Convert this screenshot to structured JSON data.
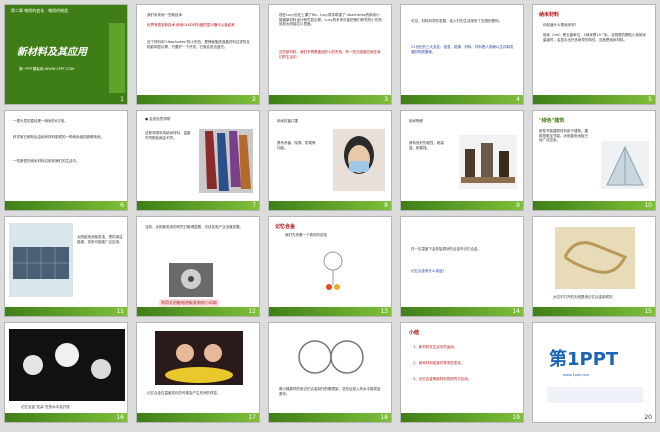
{
  "slides": [
    {
      "num": "1",
      "header": "第二章 物质的变化 · 物质的制造",
      "title": "新材料及其应用",
      "footer": "第一PPT模板网-WWW.1PPT.COM"
    },
    {
      "num": "2",
      "heading": "我们未来用一些新技术",
      "body_red": "世界有很多新技术 使用OLED材料做的显示器可以卷起来",
      "body": "这个材料叫\"Ubachsites\"的小东西，是神秘瓶底液晶材料过滤的互相影响显示屏，只要拧一下开关，它就会发出蓝光。"
    },
    {
      "num": "3",
      "body": "现在Lucy也在上课了Ten. Lucy同学希望了 Ubachsites的纳米小碳管新材料设计研究显示屏。Lucy的未来可能把他们研究的小东西放到太阳能芯片里面。",
      "body_red": "这些新材料、我们不再是遥远的人的东西，有一些已经被应用在我们的生活中。"
    },
    {
      "num": "4",
      "body": "可见，材料科学的发展，给人们的生活带来了无限的便利。",
      "body_blue": "21世纪的三大支柱：信息、能源、材料。材料是人类赖以生存和发展的物质基础。"
    },
    {
      "num": "5",
      "heading": "纳米材料",
      "q": "你知道什么是纳米吗？",
      "body": "纳米（nm）是长度单位，1纳米是10⁻⁹米。当物质的颗粒小到纳米量级时，会显示出许多奇异的特性，这就是纳米材料。"
    },
    {
      "num": "6",
      "body": "一根头发的直径是一纳米的6万倍。",
      "body2": "科学家已研制出由纳米材料制成的一种纳米级的超微电池。",
      "body3": "一些新型的纳米材料应用到我们的生活中。"
    },
    {
      "num": "7",
      "heading": "● 会变色的领带",
      "body": "这种领带采用纳米材料，温度不同颜色就会不同。"
    },
    {
      "num": "8",
      "heading": "纳米抗菌口罩",
      "body": "具有杀菌、除臭、防霉等功能。"
    },
    {
      "num": "9",
      "heading": "纳米陶瓷",
      "body": "具有良好的韧性，耐高温、耐腐蚀。"
    },
    {
      "num": "10",
      "heading": "\"绿色\"建筑",
      "body": "新型节能建筑材料用于建筑，建筑物更加节能。太阳能电池板已经广泛应用。"
    },
    {
      "num": "11",
      "body": "太阳能电池板发电，提供清洁能源，将来可能被广泛应用。"
    },
    {
      "num": "12",
      "body": "当前，太阳能电池的研究已取得进展，光伏发电产业迅速发展。",
      "caption": "利用太阳能电池板发电的小风扇"
    },
    {
      "num": "13",
      "heading": "记忆合金",
      "body": "我们先来看一个奇妙的实验"
    },
    {
      "num": "14",
      "body": "在一定温度下会恢复原状的合金叫记忆合金。",
      "body_blue": "记忆合金有什么用途？"
    },
    {
      "num": "15",
      "caption": "太空中打开的天线是用记忆合金制成的"
    },
    {
      "num": "16",
      "caption": "记忆合金\"花朵\"在热水中会开放"
    },
    {
      "num": "17",
      "body": "记忆合金在温度变化的时候会产生形状的改变。"
    },
    {
      "num": "18",
      "body": "像小猴那样的用记忆合金制作的眼镜架，变形后放入热水中能恢复原状。"
    },
    {
      "num": "19",
      "heading": "小结",
      "items": [
        "1、新材料在生活中的运用。",
        "2、纳米材料给我们带来的变化。",
        "3、记忆合金等新材料的研究与应用。"
      ]
    },
    {
      "num": "20",
      "logo": "第1PPT",
      "logo_sub": "www.1ppt.com"
    }
  ],
  "colors": {
    "green": "#3f7e16",
    "red": "#b01010",
    "blue": "#2a3fa0"
  }
}
